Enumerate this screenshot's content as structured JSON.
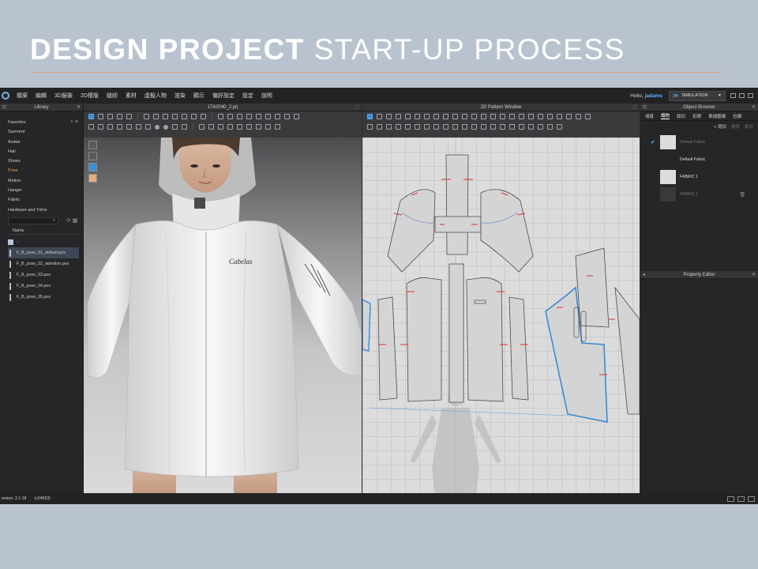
{
  "slide": {
    "title_bold": "DESIGN PROJECT",
    "title_light": "START-UP PROCESS"
  },
  "menu": {
    "items": [
      "檔案",
      "編輯",
      "3D服裝",
      "2D樣版",
      "縫紉",
      "素材",
      "虛擬人物",
      "渲染",
      "顯示",
      "偏好設定",
      "設定",
      "說明"
    ],
    "hello_prefix": "Hello,",
    "user": "jadams",
    "mode": "SIMULATION"
  },
  "library": {
    "title": "Library",
    "categories": [
      "Favorites",
      "Garment",
      "Avatar",
      "Hair",
      "Shoes",
      "Pose",
      "Motion",
      "Hanger",
      "Fabric",
      "Hardware and Trims"
    ],
    "active_category": "Pose",
    "name_header": "Name",
    "parent_folder": "..",
    "files": [
      "F_B_pose_01_default.pos",
      "F_B_pose_02_attention.pos",
      "F_B_pose_03.pos",
      "F_B_pose_04.pos",
      "F_B_pose_05.pos"
    ],
    "selected_file": "F_B_pose_01_default.pos"
  },
  "window3d": {
    "title": "17A2040_2.prj",
    "garment_text": "Cabelas"
  },
  "window2d": {
    "title": "2D Pattern Window"
  },
  "object_browser": {
    "title": "Object Browser",
    "tabs": [
      "場景",
      "織物",
      "鈕扣",
      "扣眼",
      "車縫壓線",
      "拉鍊"
    ],
    "active_tab": "織物",
    "add_label": "+ 增加",
    "copy_label": "複製",
    "delete_label": "套用",
    "fabrics": [
      {
        "name": "Default Fabric",
        "checked": true,
        "dim": true
      },
      {
        "name": "Default Fabric",
        "checked": false,
        "dim": false
      },
      {
        "name": "FABRIC 1",
        "checked": false,
        "dim": false
      },
      {
        "name": "FABRIC 1",
        "checked": false,
        "dim": true
      }
    ]
  },
  "property_editor": {
    "title": "Property Editor"
  },
  "status": {
    "version": "ersion: 3.1.18",
    "build": "(v24553)"
  },
  "colors": {
    "accent_blue": "#5fb2ff",
    "active_orange": "#ff9a32",
    "title_rule": "#e1a677",
    "slide_bg": "#b9c3d0"
  }
}
